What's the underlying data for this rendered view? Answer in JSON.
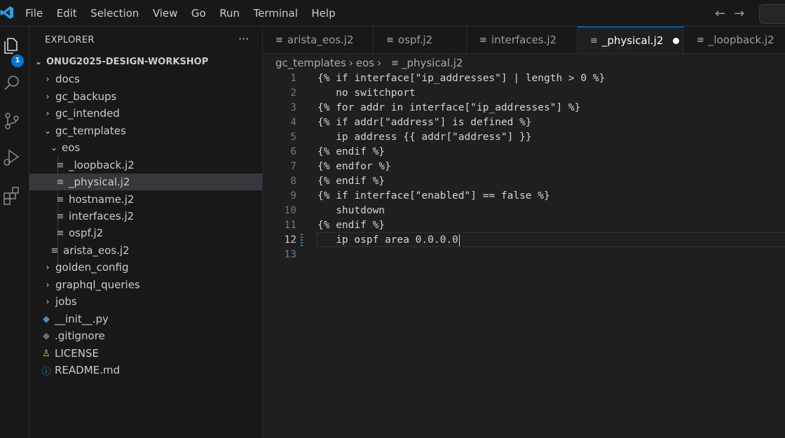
{
  "menu": [
    "File",
    "Edit",
    "Selection",
    "View",
    "Go",
    "Run",
    "Terminal",
    "Help"
  ],
  "nav": {
    "back": "←",
    "forward": "→"
  },
  "activity": {
    "explorer_badge": "1"
  },
  "sidebar": {
    "title": "EXPLORER",
    "more": "···",
    "root": "ONUG2025-DESIGN-WORKSHOP",
    "items": [
      {
        "label": "docs",
        "chev": "›",
        "icon": ""
      },
      {
        "label": "gc_backups",
        "chev": "›",
        "icon": ""
      },
      {
        "label": "gc_intended",
        "chev": "›",
        "icon": ""
      },
      {
        "label": "gc_templates",
        "chev": "⌄",
        "icon": ""
      },
      {
        "label": "eos",
        "chev": "⌄",
        "icon": ""
      },
      {
        "label": "_loopback.j2",
        "chev": "",
        "icon": "≡"
      },
      {
        "label": "_physical.j2",
        "chev": "",
        "icon": "≡"
      },
      {
        "label": "hostname.j2",
        "chev": "",
        "icon": "≡"
      },
      {
        "label": "interfaces.j2",
        "chev": "",
        "icon": "≡"
      },
      {
        "label": "ospf.j2",
        "chev": "",
        "icon": "≡"
      },
      {
        "label": "arista_eos.j2",
        "chev": "",
        "icon": "≡"
      },
      {
        "label": "golden_config",
        "chev": "›",
        "icon": ""
      },
      {
        "label": "graphql_queries",
        "chev": "›",
        "icon": ""
      },
      {
        "label": "jobs",
        "chev": "›",
        "icon": ""
      },
      {
        "label": "__init__.py",
        "chev": "",
        "icon": "◆"
      },
      {
        "label": ".gitignore",
        "chev": "",
        "icon": "◆"
      },
      {
        "label": "LICENSE",
        "chev": "",
        "icon": "♙"
      },
      {
        "label": "README.md",
        "chev": "",
        "icon": "ⓘ"
      }
    ]
  },
  "tabs": [
    {
      "label": "arista_eos.j2",
      "icon": "≡"
    },
    {
      "label": "ospf.j2",
      "icon": "≡"
    },
    {
      "label": "interfaces.j2",
      "icon": "≡"
    },
    {
      "label": "_physical.j2",
      "icon": "≡"
    },
    {
      "label": "_loopback.j2",
      "icon": "≡"
    }
  ],
  "breadcrumb": {
    "part1": "gc_templates",
    "sep": "›",
    "part2": "eos",
    "icon": "≡",
    "file": "_physical.j2"
  },
  "code_lines": [
    "{% if interface[\"ip_addresses\"] | length > 0 %}",
    "   no switchport",
    "{% for addr in interface[\"ip_addresses\"] %}",
    "{% if addr[\"address\"] is defined %}",
    "   ip address {{ addr[\"address\"] }}",
    "{% endif %}",
    "{% endfor %}",
    "{% endif %}",
    "{% if interface[\"enabled\"] == false %}",
    "   shutdown",
    "{% endif %}",
    "   ip ospf area 0.0.0.0",
    ""
  ],
  "line_numbers": [
    "1",
    "2",
    "3",
    "4",
    "5",
    "6",
    "7",
    "8",
    "9",
    "10",
    "11",
    "12",
    "13"
  ]
}
